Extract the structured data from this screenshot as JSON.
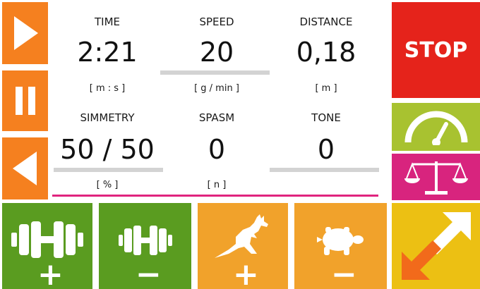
{
  "metrics": {
    "time": {
      "label": "TIME",
      "value": "2:21",
      "unit": "[ m : s ]"
    },
    "speed": {
      "label": "SPEED",
      "value": "20",
      "unit": "[ g / min ]"
    },
    "distance": {
      "label": "DISTANCE",
      "value": "0,18",
      "unit": "[ m ]"
    },
    "symmetry": {
      "label": "SIMMETRY",
      "value": "50 / 50",
      "unit": "[ % ]"
    },
    "spasm": {
      "label": "SPASM",
      "value": "0",
      "unit": "[ n ]"
    },
    "tone": {
      "label": "TONE",
      "value": "0",
      "unit": ""
    }
  },
  "controls": {
    "stop_label": "STOP",
    "weight_plus_sign": "+",
    "weight_minus_sign": "−",
    "speed_plus_sign": "+",
    "speed_minus_sign": "−",
    "play_icon": "play-icon",
    "pause_icon": "pause-icon",
    "back_icon": "reverse-icon",
    "gauge_icon": "gauge-icon",
    "scale_icon": "balance-scale-icon",
    "swap_icon": "swap-arrows-icon",
    "weight_icon": "dumbbell-icon",
    "fast_icon": "kangaroo-icon",
    "slow_icon": "turtle-icon"
  },
  "colors": {
    "orange": "#f5801f",
    "red": "#e5231b",
    "lime": "#a8c230",
    "magenta": "#d8247e",
    "yellow": "#ecc013",
    "green": "#5a9c20",
    "amber": "#f1a22b",
    "divider": "#e0247e"
  }
}
